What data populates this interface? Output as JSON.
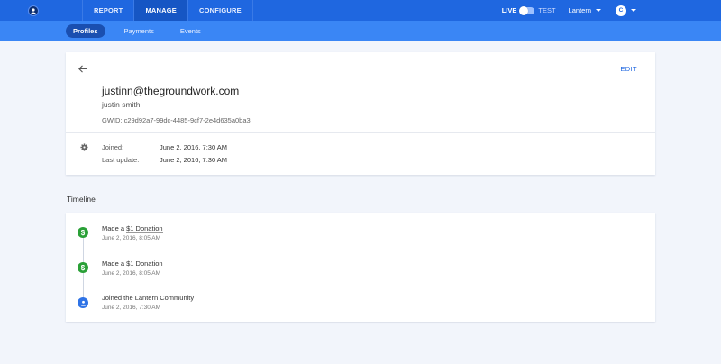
{
  "topbar": {
    "tabs": [
      {
        "label": "REPORT",
        "active": false
      },
      {
        "label": "MANAGE",
        "active": true
      },
      {
        "label": "CONFIGURE",
        "active": false
      }
    ],
    "mode_live": "LIVE",
    "mode_test": "TEST",
    "org": "Lantern",
    "user_initial": "C",
    "accent_color": "#1f67e0"
  },
  "subnav": {
    "tabs": [
      {
        "label": "Profiles",
        "active": true
      },
      {
        "label": "Payments",
        "active": false
      },
      {
        "label": "Events",
        "active": false
      }
    ]
  },
  "profile": {
    "edit_label": "EDIT",
    "email": "justinn@thegroundwork.com",
    "name": "justin smith",
    "gwid": "GWID: c29d92a7-99dc-4485-9cf7-2e4d635a0ba3",
    "joined_label": "Joined:",
    "joined_value": "June 2, 2016, 7:30 AM",
    "updated_label": "Last update:",
    "updated_value": "June 2, 2016, 7:30 AM"
  },
  "timeline": {
    "heading": "Timeline",
    "events": [
      {
        "icon": "dollar-icon",
        "prefix": "Made a ",
        "link": "$1 Donation",
        "time": "June 2, 2016, 8:05 AM"
      },
      {
        "icon": "dollar-icon",
        "prefix": "Made a ",
        "link": "$1 Donation",
        "time": "June 2, 2016, 8:05 AM"
      },
      {
        "icon": "person-icon",
        "prefix": "Joined the Lantern Community",
        "link": "",
        "time": "June 2, 2016, 7:30 AM"
      }
    ]
  },
  "icons": {
    "dollar_glyph": "$"
  }
}
